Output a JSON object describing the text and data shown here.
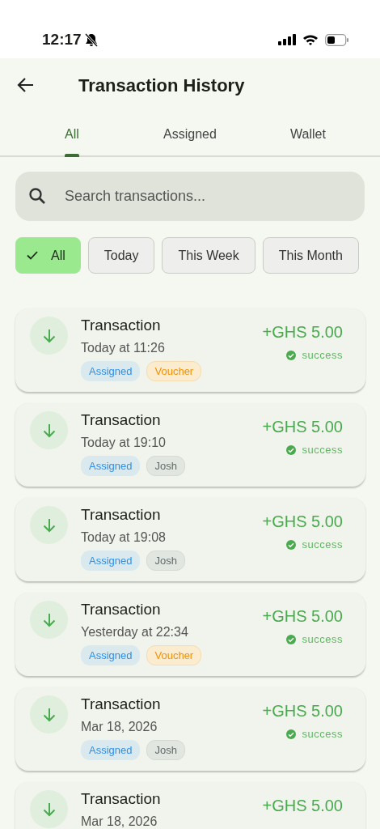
{
  "status_bar": {
    "time": "12:17",
    "muted": true
  },
  "header": {
    "title": "Transaction History"
  },
  "tabs": [
    {
      "label": "All",
      "selected": true
    },
    {
      "label": "Assigned",
      "selected": false
    },
    {
      "label": "Wallet",
      "selected": false
    }
  ],
  "search": {
    "placeholder": "Search transactions..."
  },
  "filters": [
    {
      "label": "All",
      "selected": true
    },
    {
      "label": "Today",
      "selected": false
    },
    {
      "label": "This Week",
      "selected": false
    },
    {
      "label": "This Month",
      "selected": false
    }
  ],
  "transactions": [
    {
      "title": "Transaction",
      "date": "Today at 11:26",
      "amount": "+GHS 5.00",
      "status": "success",
      "tags": [
        {
          "label": "Assigned",
          "kind": "assigned"
        },
        {
          "label": "Voucher",
          "kind": "voucher"
        }
      ]
    },
    {
      "title": "Transaction",
      "date": "Today at 19:10",
      "amount": "+GHS 5.00",
      "status": "success",
      "tags": [
        {
          "label": "Assigned",
          "kind": "assigned"
        },
        {
          "label": "Josh",
          "kind": "person"
        }
      ]
    },
    {
      "title": "Transaction",
      "date": "Today at 19:08",
      "amount": "+GHS 5.00",
      "status": "success",
      "tags": [
        {
          "label": "Assigned",
          "kind": "assigned"
        },
        {
          "label": "Josh",
          "kind": "person"
        }
      ]
    },
    {
      "title": "Transaction",
      "date": "Yesterday at 22:34",
      "amount": "+GHS 5.00",
      "status": "success",
      "tags": [
        {
          "label": "Assigned",
          "kind": "assigned"
        },
        {
          "label": "Voucher",
          "kind": "voucher"
        }
      ]
    },
    {
      "title": "Transaction",
      "date": "Mar 18, 2026",
      "amount": "+GHS 5.00",
      "status": "success",
      "tags": [
        {
          "label": "Assigned",
          "kind": "assigned"
        },
        {
          "label": "Josh",
          "kind": "person"
        }
      ]
    },
    {
      "title": "Transaction",
      "date": "Mar 18, 2026",
      "amount": "+GHS 5.00"
    }
  ]
}
